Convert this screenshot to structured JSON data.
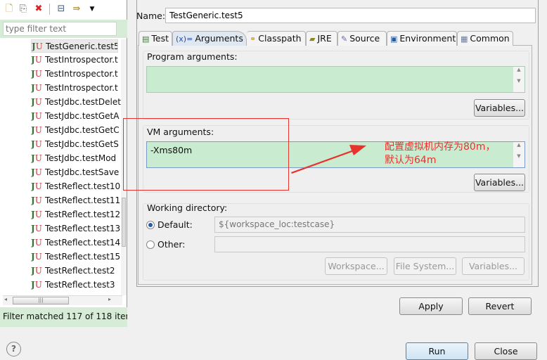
{
  "left_panel": {
    "toolbar": [
      "new-config-icon",
      "duplicate-icon",
      "delete-icon",
      "collapse-all-icon",
      "filter-icon",
      "dropdown-icon"
    ],
    "filter_placeholder": "type filter text",
    "items": [
      "TestGeneric.test5",
      "TestIntrospector.t",
      "TestIntrospector.t",
      "TestIntrospector.t",
      "TestJdbc.testDelet",
      "TestJdbc.testGetA",
      "TestJdbc.testGetC",
      "TestJdbc.testGetS",
      "TestJdbc.testMod",
      "TestJdbc.testSave",
      "TestReflect.test10",
      "TestReflect.test11",
      "TestReflect.test12",
      "TestReflect.test13",
      "TestReflect.test14",
      "TestReflect.test15",
      "TestReflect.test2",
      "TestReflect.test3"
    ],
    "selected_index": 0,
    "status": "Filter matched 117 of 118 item"
  },
  "config": {
    "name_label": "Name:",
    "name_value": "TestGeneric.test5",
    "tabs": [
      {
        "label": "Test",
        "icon": "test-icon"
      },
      {
        "label": "Arguments",
        "icon": "(x)="
      },
      {
        "label": "Classpath",
        "icon": "classpath-icon"
      },
      {
        "label": "JRE",
        "icon": "jre-icon"
      },
      {
        "label": "Source",
        "icon": "source-icon"
      },
      {
        "label": "Environment",
        "icon": "environment-icon"
      },
      {
        "label": "Common",
        "icon": "common-icon"
      }
    ],
    "active_tab": "Arguments",
    "program_args_label": "Program arguments:",
    "program_args_value": "",
    "variables_label": "Variables...",
    "vm_args_label": "VM arguments:",
    "vm_args_value": "-Xms80m",
    "working_dir_label": "Working directory:",
    "default_label": "Default:",
    "default_value": "${workspace_loc:testcase}",
    "other_label": "Other:",
    "other_value": "",
    "workspace_btn": "Workspace...",
    "filesystem_btn": "File System...",
    "apply": "Apply",
    "revert": "Revert"
  },
  "annotation": {
    "line1": "配置虚拟机内存为80m，",
    "line2": "默认为64m",
    "color": "#e8322e"
  },
  "footer": {
    "help": "?",
    "run": "Run",
    "close": "Close"
  }
}
